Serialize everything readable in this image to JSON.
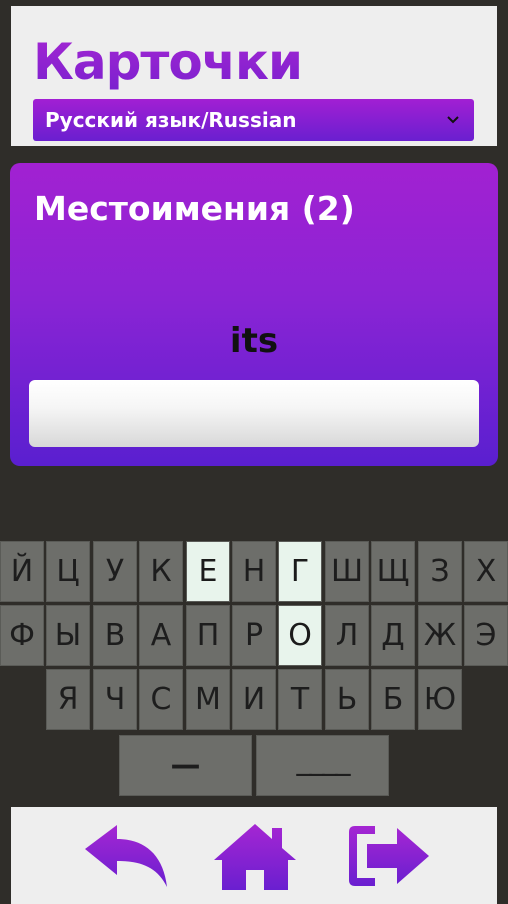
{
  "app": {
    "title": "Карточки"
  },
  "language_select": {
    "value": "Русский язык/Russian"
  },
  "card": {
    "title": "Местоимения (2)",
    "prompt": "its",
    "answer_value": ""
  },
  "keyboard": {
    "row1": [
      "Й",
      "Ц",
      "У",
      "К",
      "Е",
      "Н",
      "Г",
      "Ш",
      "Щ",
      "З",
      "Х"
    ],
    "row2": [
      "Ф",
      "Ы",
      "В",
      "А",
      "П",
      "Р",
      "О",
      "Л",
      "Д",
      "Ж",
      "Э"
    ],
    "row3": [
      "Я",
      "Ч",
      "С",
      "М",
      "И",
      "Т",
      "Ь",
      "Б",
      "Ю"
    ],
    "row4": [
      "—",
      "____"
    ],
    "highlighted": [
      "Е",
      "Г",
      "О"
    ]
  },
  "footer": {
    "buttons": [
      {
        "icon": "back-arrow-icon"
      },
      {
        "icon": "home-icon"
      },
      {
        "icon": "exit-icon"
      }
    ]
  },
  "colors": {
    "accent_purple": "#8e22d2",
    "deep_violet": "#5a1fd0",
    "key_gray": "#6d6e6a",
    "key_highlight": "#e8f4ec",
    "background": "#2f2d29"
  }
}
